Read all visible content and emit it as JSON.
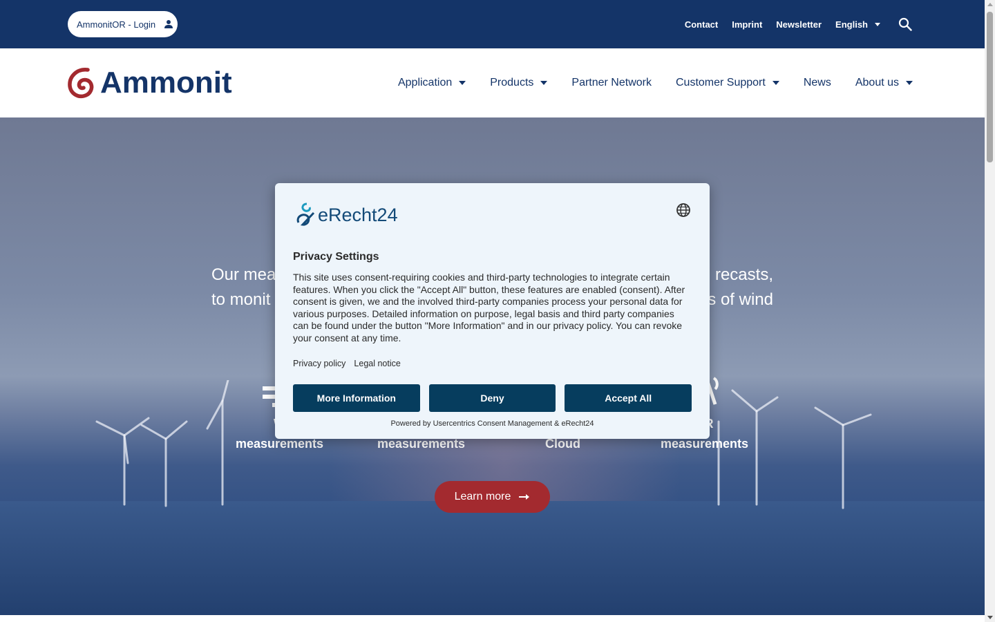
{
  "topbar": {
    "login_label": "AmmonitOR - Login",
    "links": [
      "Contact",
      "Imprint",
      "Newsletter"
    ],
    "language": "English"
  },
  "header": {
    "logo_text": "Ammonit",
    "nav": [
      {
        "label": "Application",
        "dropdown": true
      },
      {
        "label": "Products",
        "dropdown": true
      },
      {
        "label": "Partner Network",
        "dropdown": false
      },
      {
        "label": "Customer Support",
        "dropdown": true
      },
      {
        "label": "News",
        "dropdown": false
      },
      {
        "label": "About us",
        "dropdown": true
      }
    ]
  },
  "hero": {
    "line1_left": "Our mea",
    "line1_right": "recasts,",
    "line2_left": "to monit",
    "line2_right": "s of wind",
    "features": [
      {
        "line1": "W",
        "line2": "measurements"
      },
      {
        "line1": "",
        "line2": "measurements"
      },
      {
        "line1": "",
        "line2": "Cloud"
      },
      {
        "line1": "AR",
        "line2": "measurements"
      }
    ],
    "learn_more": "Learn more"
  },
  "consent": {
    "brand": "eRecht24",
    "title": "Privacy Settings",
    "body": "This site uses consent-requiring cookies and third-party technologies to integrate certain features. When you click the \"Accept All\" button, these features are enabled (consent). After consent is given, we and the involved third-party companies process your personal data for various purposes. Detailed information on purpose, legal basis and third party companies can be found under the button \"More Information\" and in our privacy policy. You can revoke your consent at any time.",
    "links": [
      "Privacy policy",
      "Legal notice"
    ],
    "buttons": {
      "more": "More Information",
      "deny": "Deny",
      "accept": "Accept All"
    },
    "powered": "Powered by Usercentrics Consent Management & eRecht24"
  },
  "colors": {
    "navy": "#143468",
    "brand_red": "#a32a2f",
    "consent_button": "#063d5e",
    "consent_bg": "#eef5fb"
  }
}
